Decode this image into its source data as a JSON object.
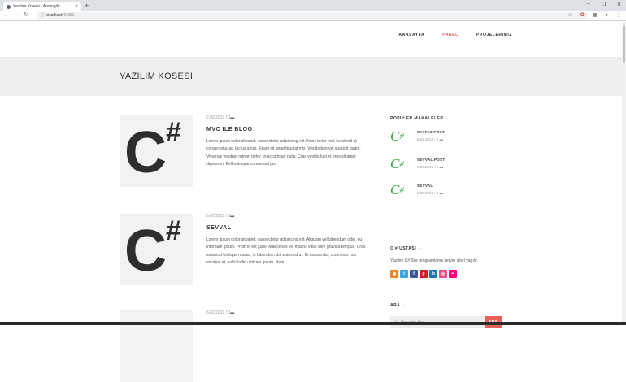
{
  "browser": {
    "tab_title": "Yazılım Kosesi - Anasayfa",
    "url_host": "localhost",
    "url_port": ":49351"
  },
  "nav": {
    "items": [
      "ANASAYFA",
      "PANEL",
      "PROJELERIMIZ"
    ],
    "active_color": "#e8615b"
  },
  "hero": {
    "title": "YAZILIM KOSESI"
  },
  "posts": [
    {
      "date": "2.02.2019",
      "comments": "0",
      "title": "MVC ILE BLOG",
      "excerpt": "Lorem ipsum dolor sit amet, consectetur adipiscing elit. Nunc tortor nisl, hendrerit at consectetur ac, luctus a nisi. Etiam sit amet feugiat mis. Vestibulum vel suscipit quam. Vivamus volutpat rutrum tortor, in accumsan nulla. Cras vestibulum et eros sit amet dignissim. Pellentesque consequat just"
    },
    {
      "date": "6.02.2019",
      "comments": "0",
      "title": "SEVVAL",
      "excerpt": "Lorem ipsum dolor sit amet, consectetur adipiscing elit. Aliquam vel bibendum odio, eu interdum ipsum. Proin id elit justo. Maecenas vel mauris vitae sem gravida tempus. Cras euismod tristique massa, in bibendum dui euismod ut. Ut massa dui, commodo non volutpat et, sollicitudin ultricies ipsum. Nam"
    },
    {
      "date": "6.02.2019",
      "comments": "0"
    }
  ],
  "sidebar": {
    "popular_title": "POPULER MAKALELER",
    "popular": [
      {
        "title": "SAYFA2 POST",
        "date": "6.02.2019",
        "comments": "0"
      },
      {
        "title": "SEVVAL POST",
        "date": "6.02.2019",
        "comments": "0"
      },
      {
        "title": "SEVVAL",
        "date": "6.02.2019",
        "comments": "0"
      }
    ],
    "about_title": "C # USTASI",
    "about_text": "Yazılım C# Site programlama server işleri yapılır.",
    "socials": [
      {
        "icon": "rss-icon",
        "color": "#f58220"
      },
      {
        "icon": "twitter-icon",
        "color": "#3aa3e3"
      },
      {
        "icon": "facebook-icon",
        "color": "#3b5998"
      },
      {
        "icon": "pinterest-icon",
        "color": "#cb2027"
      },
      {
        "icon": "linkedin-icon",
        "color": "#1a7bb3"
      },
      {
        "icon": "dribbble-icon",
        "color": "#ea4c89"
      },
      {
        "icon": "flickr-icon",
        "color": "#ff0084"
      }
    ],
    "search_title": "ARA",
    "search_placeholder": "Birşeyler Ara",
    "search_button": "ARA"
  }
}
